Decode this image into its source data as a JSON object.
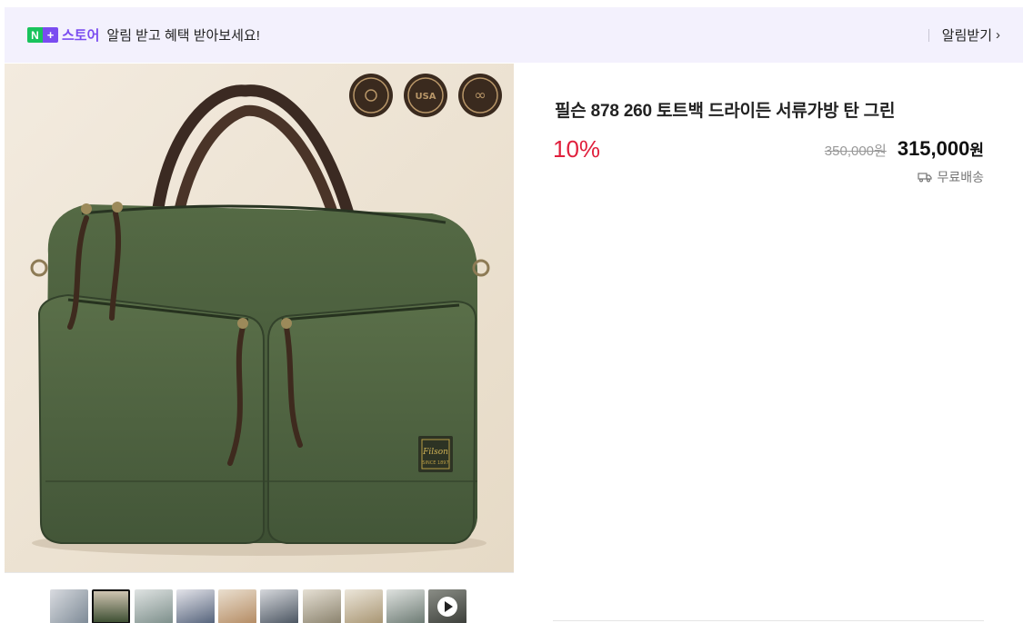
{
  "banner": {
    "logo_n": "N",
    "logo_plus": "+",
    "logo_text": "스토어",
    "message": "알림 받고 혜택 받아보세요!",
    "notify_label": "알림받기",
    "notify_chevron": "›",
    "colors": {
      "background": "#f3f1fd",
      "logo_green": "#19c35c",
      "logo_purple": "#7a4cf0"
    }
  },
  "product": {
    "title": "필슨 878 260 토트백 드라이든 서류가방 탄 그린",
    "discount": "10%",
    "original_price": "350,000원",
    "sale_price": "315,000",
    "currency": "원",
    "shipping": "무료배송",
    "shipping_icon": "truck-icon",
    "image_badges": [
      "seal-icon",
      "made-in-usa-badge",
      "lifetime-guarantee-badge"
    ],
    "colors": {
      "discount": "#e0203d"
    }
  },
  "thumbnails": {
    "items": [
      {
        "name": "thumbnail-1",
        "active": false
      },
      {
        "name": "thumbnail-2",
        "active": true
      },
      {
        "name": "thumbnail-3",
        "active": false
      },
      {
        "name": "thumbnail-4",
        "active": false
      },
      {
        "name": "thumbnail-5",
        "active": false
      },
      {
        "name": "thumbnail-6",
        "active": false
      },
      {
        "name": "thumbnail-7",
        "active": false
      },
      {
        "name": "thumbnail-8",
        "active": false
      },
      {
        "name": "thumbnail-9",
        "active": false
      },
      {
        "name": "thumbnail-video",
        "active": false,
        "icon": "play-icon"
      }
    ]
  }
}
